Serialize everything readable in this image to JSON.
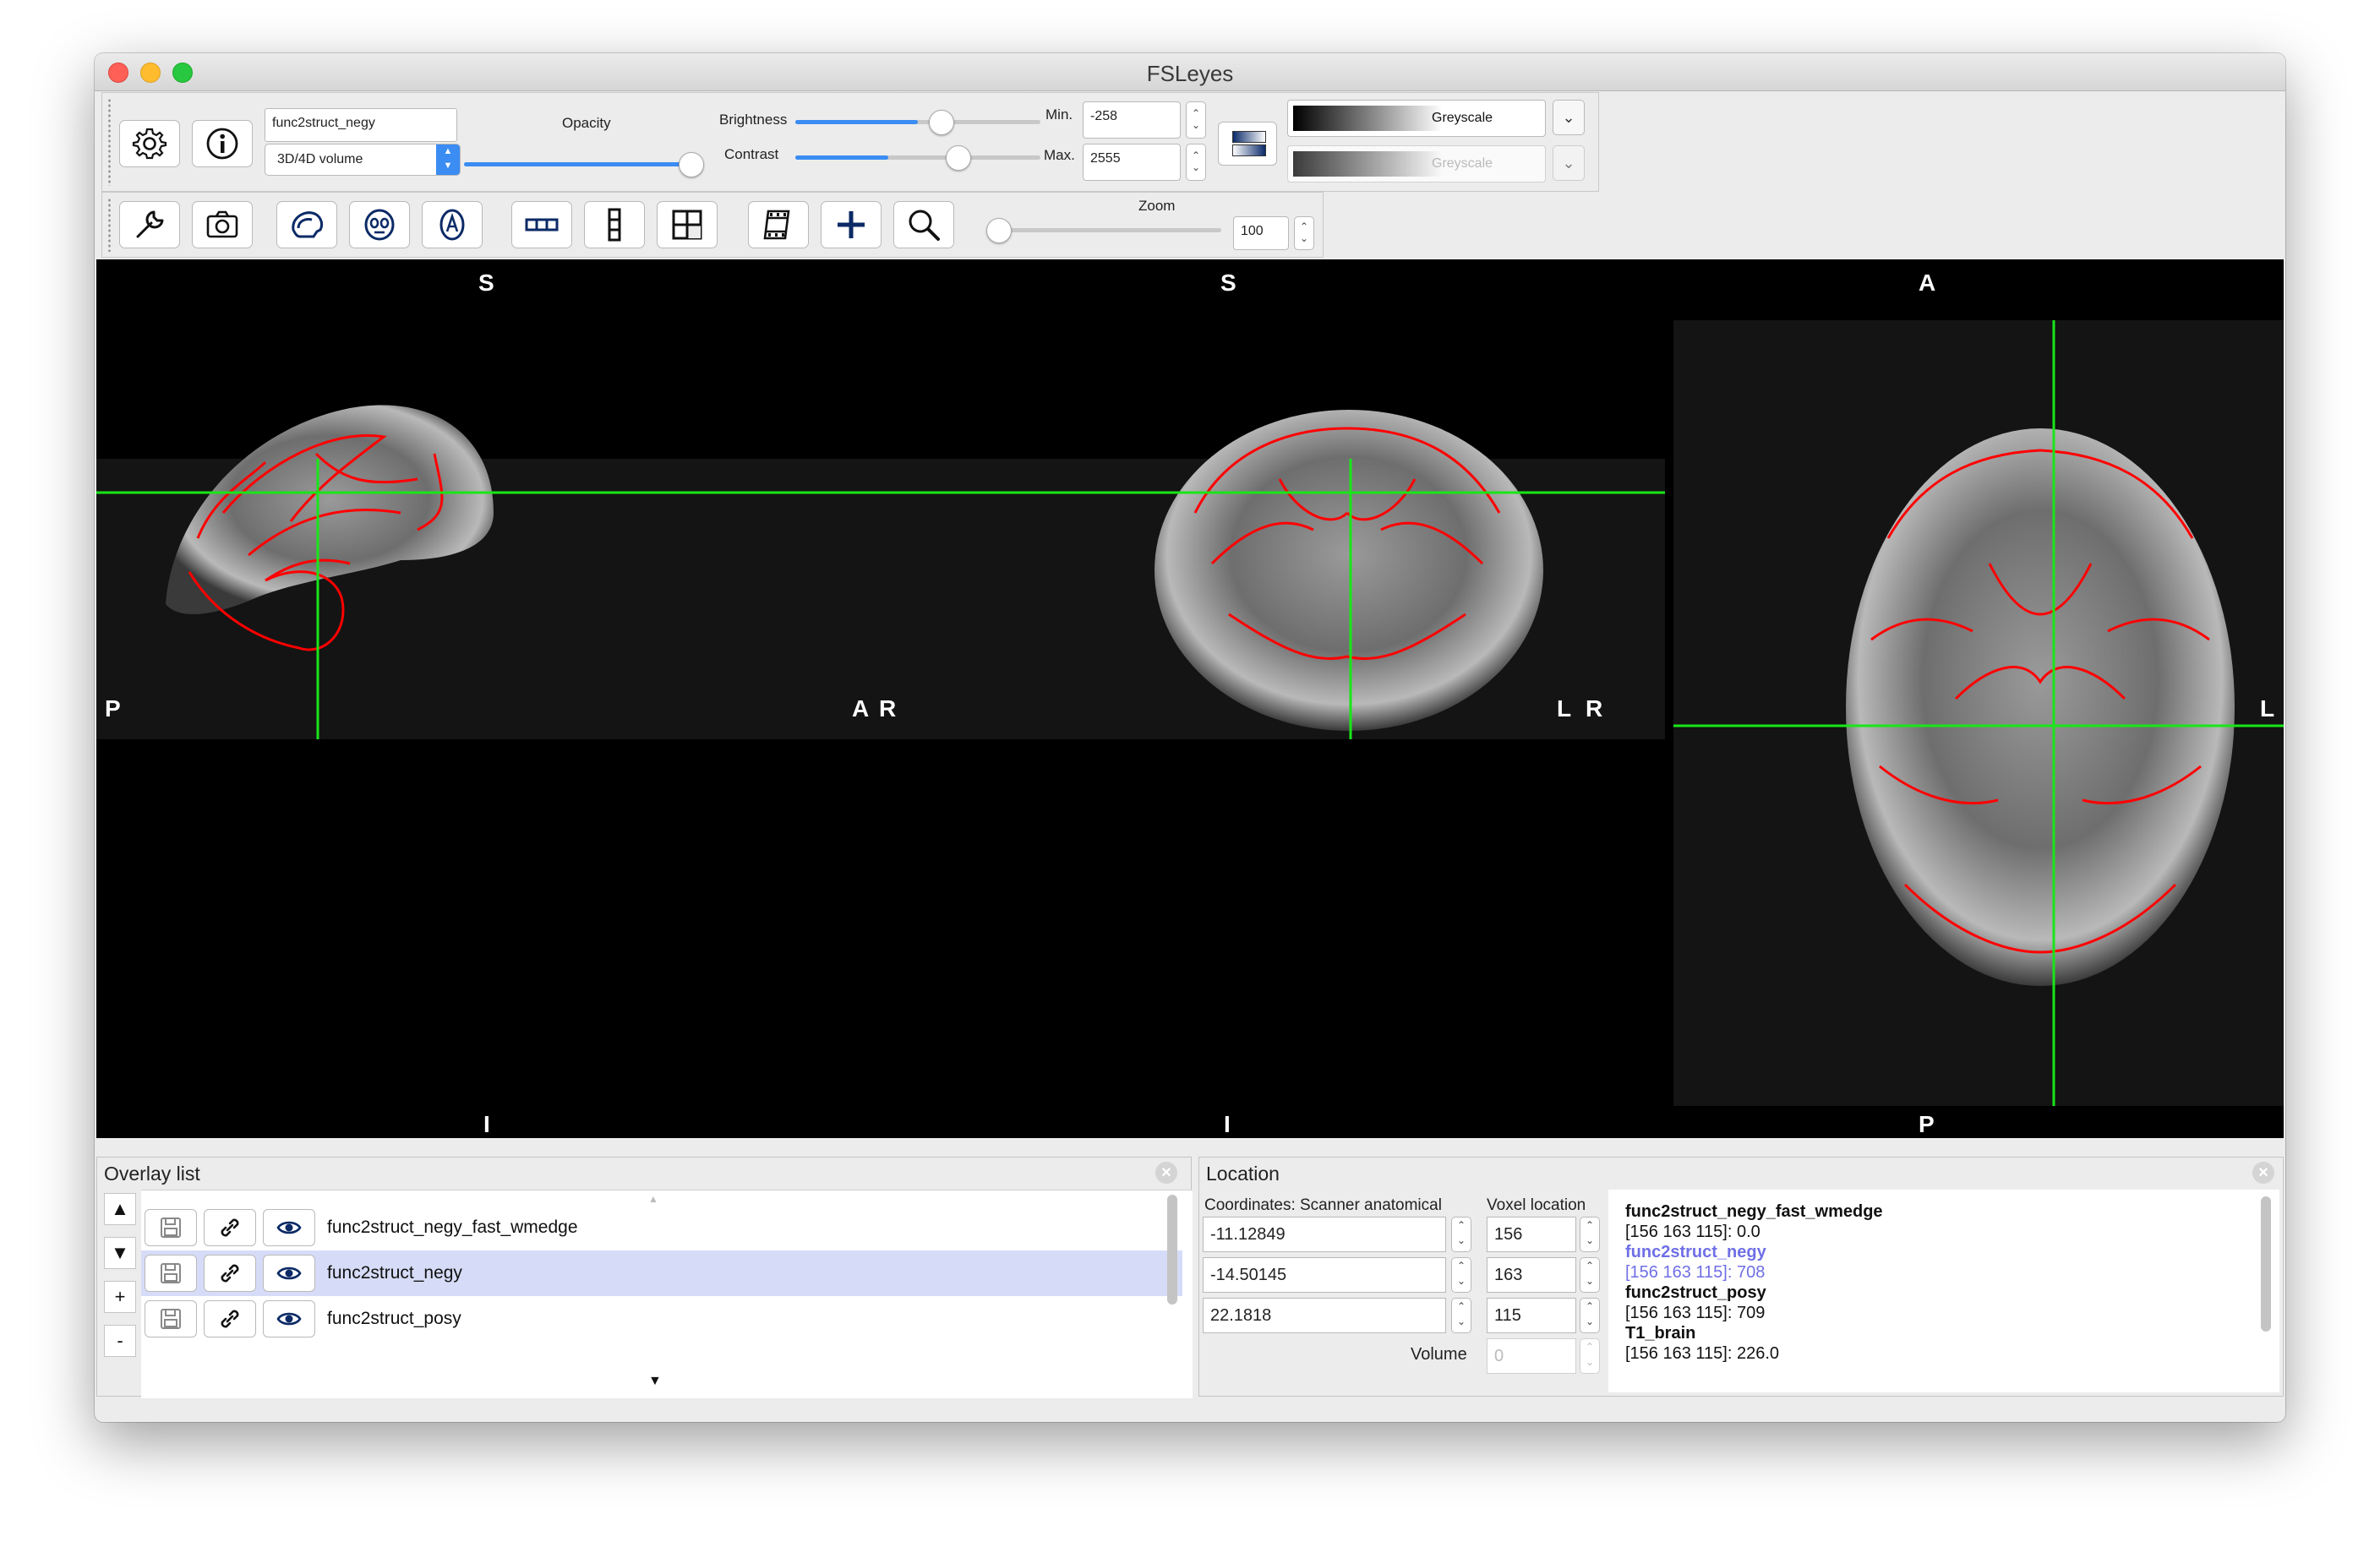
{
  "window": {
    "title": "FSLeyes"
  },
  "overlay_toolbar": {
    "overlay_name": "func2struct_negy",
    "overlay_type": "3D/4D volume",
    "opacity_label": "Opacity",
    "opacity_value": 1.0,
    "brightness_label": "Brightness",
    "brightness_value": 0.5,
    "contrast_label": "Contrast",
    "contrast_value": 0.5,
    "min_label": "Min.",
    "min_value": "-258",
    "max_label": "Max.",
    "max_value": "2555",
    "colormap": "Greyscale",
    "neg_colormap": "Greyscale"
  },
  "view_toolbar": {
    "zoom_label": "Zoom",
    "zoom_value": "100"
  },
  "ortho": {
    "sagittal": {
      "top": "S",
      "bottom": "I",
      "left": "P",
      "right": "A"
    },
    "coronal": {
      "top": "S",
      "bottom": "I",
      "left": "R",
      "right": "L"
    },
    "axial": {
      "top": "A",
      "bottom": "P",
      "left": "R",
      "right": "L"
    },
    "crosshair_color": "#19e619",
    "edge_color": "#ff0000"
  },
  "overlay_list": {
    "title": "Overlay list",
    "controls": [
      "▲",
      "▼",
      "+",
      "-"
    ],
    "items": [
      {
        "name": "func2struct_negy_fast_wmedge",
        "selected": false
      },
      {
        "name": "func2struct_negy",
        "selected": true
      },
      {
        "name": "func2struct_posy",
        "selected": false
      }
    ]
  },
  "location": {
    "title": "Location",
    "coord_label": "Coordinates: Scanner anatomical",
    "voxel_label": "Voxel location",
    "coords": [
      "-11.12849",
      "-14.50145",
      "22.1818"
    ],
    "voxels": [
      "156",
      "163",
      "115"
    ],
    "volume_label": "Volume",
    "volume_value": "0",
    "info": [
      {
        "name": "func2struct_negy_fast_wmedge",
        "value": "[156 163 115]: 0.0",
        "highlight": false
      },
      {
        "name": "func2struct_negy",
        "value": "[156 163 115]: 708",
        "highlight": true
      },
      {
        "name": "func2struct_posy",
        "value": "[156 163 115]: 709",
        "highlight": false
      },
      {
        "name": "T1_brain",
        "value": "[156 163 115]: 226.0",
        "highlight": false
      }
    ]
  }
}
